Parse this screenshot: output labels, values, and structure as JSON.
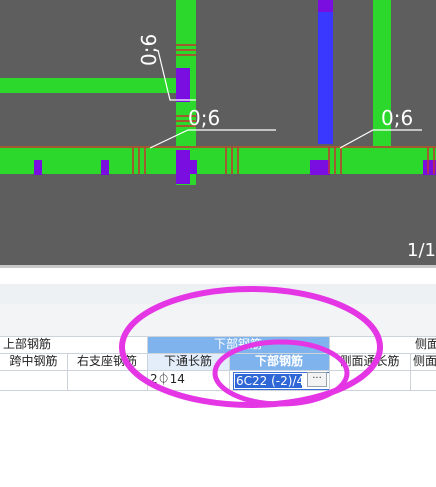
{
  "drawing": {
    "dimension_labels": [
      "0;6",
      "0;6",
      "0;6"
    ],
    "page_indicator": "1/1"
  },
  "grid": {
    "group_headers": {
      "top_rebar": "上部钢筋",
      "bottom_rebar": "下部钢筋",
      "side": "侧面"
    },
    "columns": [
      "跨中钢筋",
      "右支座钢筋",
      "下通长筋",
      "下部钢筋",
      "侧面通长筋",
      "侧面"
    ],
    "row": {
      "bottom_through": "2⏀14",
      "bottom_rebar_value": "6C22 (-2)/4"
    },
    "ellipsis_label": "···"
  },
  "colors": {
    "beam": "#2bd82b",
    "column": "#7a0ee0",
    "wall": "#3a38ff",
    "rebar_mark": "#c83232",
    "header_blue": "#7fb3ee",
    "highlight_outline": "#e436e4"
  }
}
